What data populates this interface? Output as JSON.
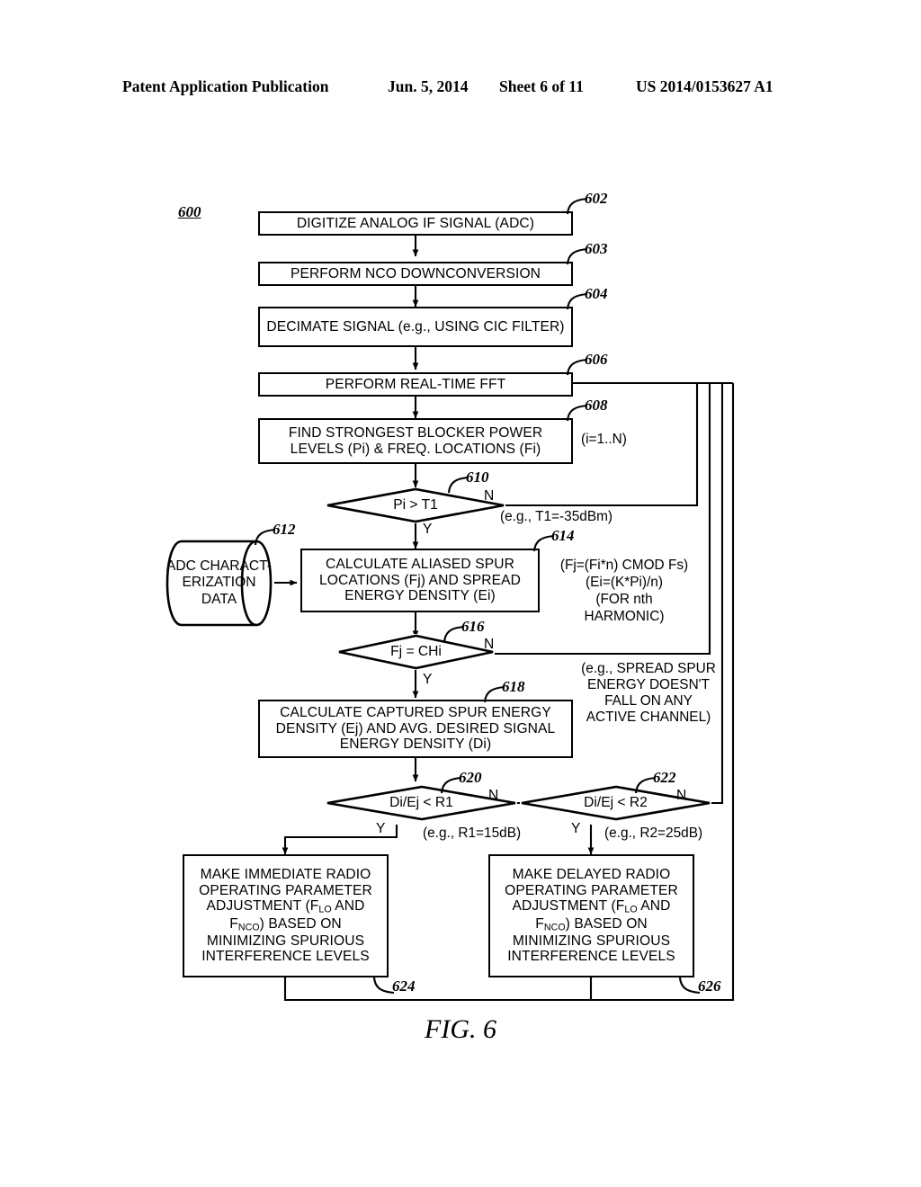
{
  "header": {
    "publication": "Patent Application Publication",
    "date": "Jun. 5, 2014",
    "sheet": "Sheet 6 of 11",
    "patent_number": "US 2014/0153627 A1"
  },
  "figure": {
    "caption": "FIG. 6",
    "diagram_ref": "600"
  },
  "nodes": {
    "n602": {
      "ref": "602",
      "text": "DIGITIZE ANALOG IF SIGNAL (ADC)"
    },
    "n603": {
      "ref": "603",
      "text": "PERFORM NCO DOWNCONVERSION"
    },
    "n604": {
      "ref": "604",
      "text": "DECIMATE SIGNAL (e.g., USING CIC FILTER)"
    },
    "n606": {
      "ref": "606",
      "text": "PERFORM REAL-TIME FFT"
    },
    "n608": {
      "ref": "608",
      "text": "FIND STRONGEST BLOCKER POWER LEVELS (Pi) & FREQ. LOCATIONS (Fi)"
    },
    "n610": {
      "ref": "610",
      "text": "Pi > T1"
    },
    "n612": {
      "ref": "612",
      "text": "ADC CHARACT-ERIZATION DATA"
    },
    "n614": {
      "ref": "614",
      "text": "CALCULATE ALIASED SPUR LOCATIONS (Fj) AND SPREAD ENERGY DENSITY (Ei)"
    },
    "n616": {
      "ref": "616",
      "text": "Fj = CHi"
    },
    "n618": {
      "ref": "618",
      "text": "CALCULATE CAPTURED SPUR ENERGY DENSITY (Ej) AND AVG. DESIRED SIGNAL ENERGY DENSITY (Di)"
    },
    "n620": {
      "ref": "620",
      "text": "Di/Ej < R1"
    },
    "n622": {
      "ref": "622",
      "text": "Di/Ej < R2"
    },
    "n624": {
      "ref": "624",
      "text": "MAKE IMMEDIATE RADIO OPERATING PARAMETER ADJUSTMENT (F<sub>LO</sub> AND F<sub>NCO</sub>) BASED ON MINIMIZING SPURIOUS INTERFERENCE LEVELS"
    },
    "n626": {
      "ref": "626",
      "text": "MAKE DELAYED RADIO OPERATING PARAMETER ADJUSTMENT (F<sub>LO</sub> AND F<sub>NCO</sub>) BASED ON MINIMIZING SPURIOUS INTERFERENCE LEVELS"
    }
  },
  "annotations": {
    "index_range": "(i=1..N)",
    "t1_example": "(e.g., T1=-35dBm)",
    "formula_fj": "(Fj=(Fi*n) CMOD Fs)",
    "formula_ei": "(Ei=(K*Pi)/n)",
    "formula_for": "(FOR nth",
    "formula_harmonic": "HARMONIC)",
    "spur_note": "(e.g., SPREAD SPUR ENERGY DOESN'T FALL ON ANY ACTIVE CHANNEL)",
    "r1_example": "(e.g., R1=15dB)",
    "r2_example": "(e.g., R2=25dB)"
  },
  "branches": {
    "n610_yes": "Y",
    "n610_no": "N",
    "n616_yes": "Y",
    "n616_no": "N",
    "n620_yes": "Y",
    "n620_no": "N",
    "n622_yes": "Y",
    "n622_no": "N"
  }
}
